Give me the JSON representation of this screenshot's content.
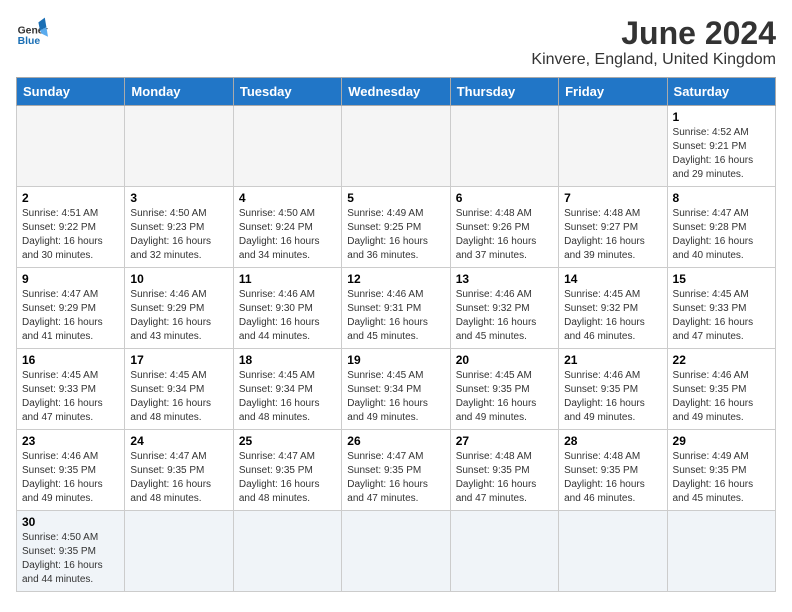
{
  "header": {
    "logo_general": "General",
    "logo_blue": "Blue",
    "title": "June 2024",
    "subtitle": "Kinvere, England, United Kingdom"
  },
  "weekdays": [
    "Sunday",
    "Monday",
    "Tuesday",
    "Wednesday",
    "Thursday",
    "Friday",
    "Saturday"
  ],
  "weeks": [
    [
      {
        "day": "",
        "info": ""
      },
      {
        "day": "",
        "info": ""
      },
      {
        "day": "",
        "info": ""
      },
      {
        "day": "",
        "info": ""
      },
      {
        "day": "",
        "info": ""
      },
      {
        "day": "",
        "info": ""
      },
      {
        "day": "1",
        "info": "Sunrise: 4:52 AM\nSunset: 9:21 PM\nDaylight: 16 hours\nand 29 minutes."
      }
    ],
    [
      {
        "day": "2",
        "info": "Sunrise: 4:51 AM\nSunset: 9:22 PM\nDaylight: 16 hours\nand 30 minutes."
      },
      {
        "day": "3",
        "info": "Sunrise: 4:50 AM\nSunset: 9:23 PM\nDaylight: 16 hours\nand 32 minutes."
      },
      {
        "day": "4",
        "info": "Sunrise: 4:50 AM\nSunset: 9:24 PM\nDaylight: 16 hours\nand 34 minutes."
      },
      {
        "day": "5",
        "info": "Sunrise: 4:49 AM\nSunset: 9:25 PM\nDaylight: 16 hours\nand 36 minutes."
      },
      {
        "day": "6",
        "info": "Sunrise: 4:48 AM\nSunset: 9:26 PM\nDaylight: 16 hours\nand 37 minutes."
      },
      {
        "day": "7",
        "info": "Sunrise: 4:48 AM\nSunset: 9:27 PM\nDaylight: 16 hours\nand 39 minutes."
      },
      {
        "day": "8",
        "info": "Sunrise: 4:47 AM\nSunset: 9:28 PM\nDaylight: 16 hours\nand 40 minutes."
      }
    ],
    [
      {
        "day": "9",
        "info": "Sunrise: 4:47 AM\nSunset: 9:29 PM\nDaylight: 16 hours\nand 41 minutes."
      },
      {
        "day": "10",
        "info": "Sunrise: 4:46 AM\nSunset: 9:29 PM\nDaylight: 16 hours\nand 43 minutes."
      },
      {
        "day": "11",
        "info": "Sunrise: 4:46 AM\nSunset: 9:30 PM\nDaylight: 16 hours\nand 44 minutes."
      },
      {
        "day": "12",
        "info": "Sunrise: 4:46 AM\nSunset: 9:31 PM\nDaylight: 16 hours\nand 45 minutes."
      },
      {
        "day": "13",
        "info": "Sunrise: 4:46 AM\nSunset: 9:32 PM\nDaylight: 16 hours\nand 45 minutes."
      },
      {
        "day": "14",
        "info": "Sunrise: 4:45 AM\nSunset: 9:32 PM\nDaylight: 16 hours\nand 46 minutes."
      },
      {
        "day": "15",
        "info": "Sunrise: 4:45 AM\nSunset: 9:33 PM\nDaylight: 16 hours\nand 47 minutes."
      }
    ],
    [
      {
        "day": "16",
        "info": "Sunrise: 4:45 AM\nSunset: 9:33 PM\nDaylight: 16 hours\nand 47 minutes."
      },
      {
        "day": "17",
        "info": "Sunrise: 4:45 AM\nSunset: 9:34 PM\nDaylight: 16 hours\nand 48 minutes."
      },
      {
        "day": "18",
        "info": "Sunrise: 4:45 AM\nSunset: 9:34 PM\nDaylight: 16 hours\nand 48 minutes."
      },
      {
        "day": "19",
        "info": "Sunrise: 4:45 AM\nSunset: 9:34 PM\nDaylight: 16 hours\nand 49 minutes."
      },
      {
        "day": "20",
        "info": "Sunrise: 4:45 AM\nSunset: 9:35 PM\nDaylight: 16 hours\nand 49 minutes."
      },
      {
        "day": "21",
        "info": "Sunrise: 4:46 AM\nSunset: 9:35 PM\nDaylight: 16 hours\nand 49 minutes."
      },
      {
        "day": "22",
        "info": "Sunrise: 4:46 AM\nSunset: 9:35 PM\nDaylight: 16 hours\nand 49 minutes."
      }
    ],
    [
      {
        "day": "23",
        "info": "Sunrise: 4:46 AM\nSunset: 9:35 PM\nDaylight: 16 hours\nand 49 minutes."
      },
      {
        "day": "24",
        "info": "Sunrise: 4:47 AM\nSunset: 9:35 PM\nDaylight: 16 hours\nand 48 minutes."
      },
      {
        "day": "25",
        "info": "Sunrise: 4:47 AM\nSunset: 9:35 PM\nDaylight: 16 hours\nand 48 minutes."
      },
      {
        "day": "26",
        "info": "Sunrise: 4:47 AM\nSunset: 9:35 PM\nDaylight: 16 hours\nand 47 minutes."
      },
      {
        "day": "27",
        "info": "Sunrise: 4:48 AM\nSunset: 9:35 PM\nDaylight: 16 hours\nand 47 minutes."
      },
      {
        "day": "28",
        "info": "Sunrise: 4:48 AM\nSunset: 9:35 PM\nDaylight: 16 hours\nand 46 minutes."
      },
      {
        "day": "29",
        "info": "Sunrise: 4:49 AM\nSunset: 9:35 PM\nDaylight: 16 hours\nand 45 minutes."
      }
    ],
    [
      {
        "day": "30",
        "info": "Sunrise: 4:50 AM\nSunset: 9:35 PM\nDaylight: 16 hours\nand 44 minutes."
      },
      {
        "day": "",
        "info": ""
      },
      {
        "day": "",
        "info": ""
      },
      {
        "day": "",
        "info": ""
      },
      {
        "day": "",
        "info": ""
      },
      {
        "day": "",
        "info": ""
      },
      {
        "day": "",
        "info": ""
      }
    ]
  ]
}
